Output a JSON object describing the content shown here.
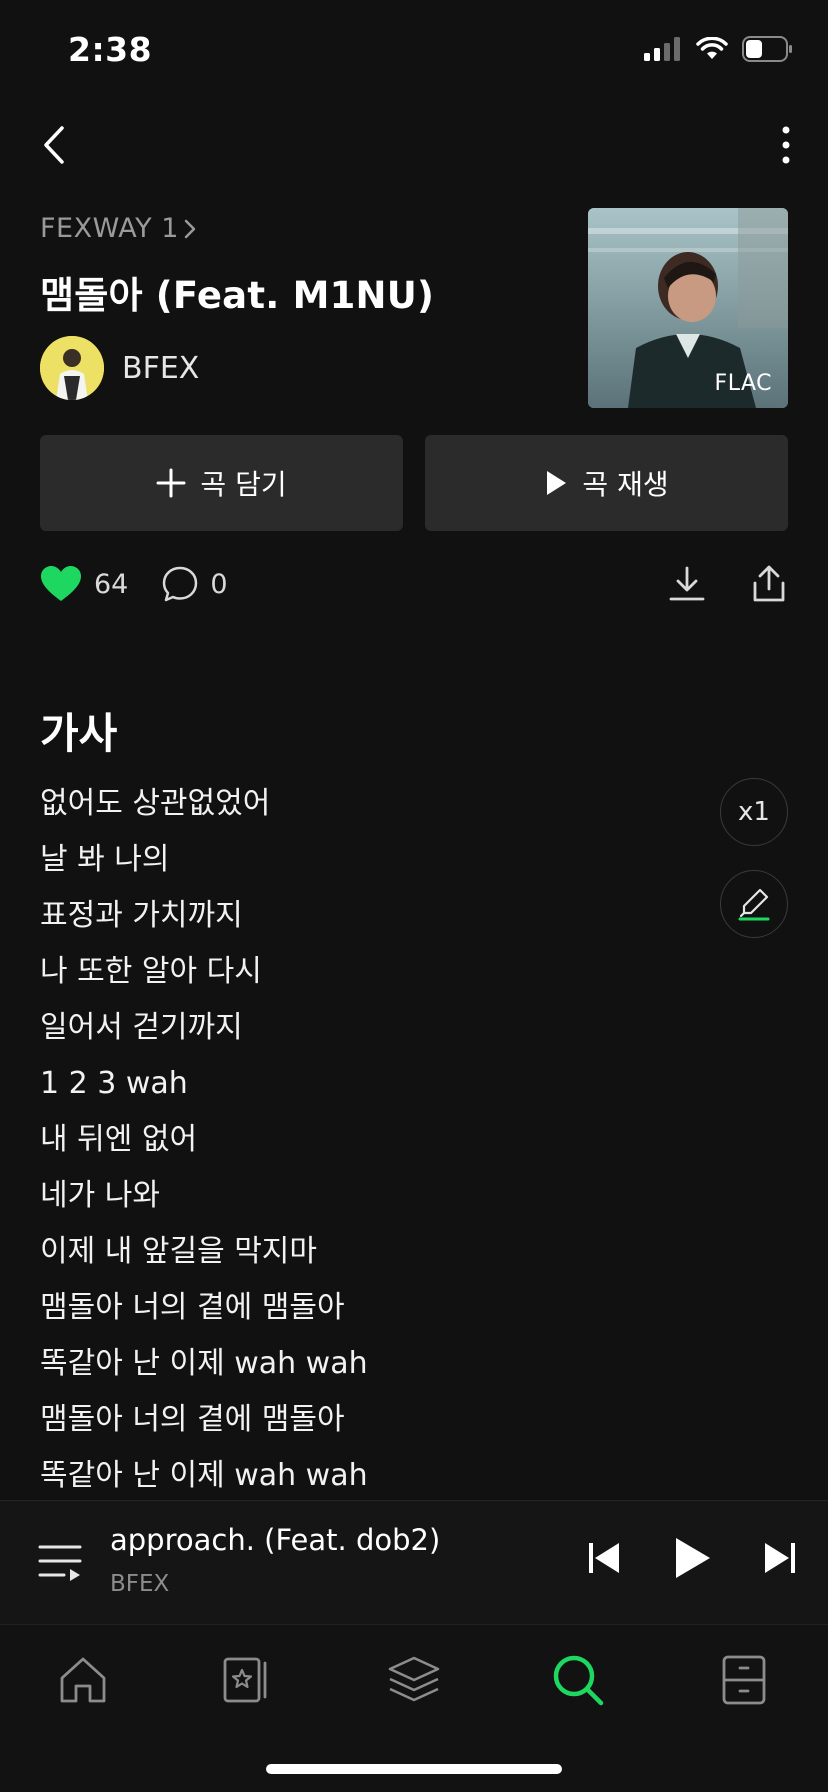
{
  "status_bar": {
    "time": "2:38"
  },
  "song": {
    "album": "FEXWAY 1",
    "title": "맴돌아 (Feat. M1NU)",
    "artist": "BFEX",
    "quality_badge": "FLAC"
  },
  "actions": {
    "add_label": "곡 담기",
    "play_label": "곡 재생"
  },
  "stats": {
    "likes": "64",
    "comments": "0"
  },
  "lyrics": {
    "heading": "가사",
    "speed_label": "x1",
    "lines": [
      "없어도 상관없었어",
      "날 봐 나의",
      "표정과 가치까지",
      "나 또한 알아 다시",
      "일어서 걷기까지",
      "1 2 3 wah",
      "내 뒤엔 없어",
      "네가 나와",
      "이제 내 앞길을 막지마",
      "맴돌아 너의 곁에 맴돌아",
      "똑같아 난 이제 wah wah",
      "맴돌아 너의 곁에 맴돌아",
      "똑같아 난 이제 wah wah"
    ]
  },
  "mini_player": {
    "title": "approach. (Feat. dob2)",
    "artist": "BFEX"
  },
  "colors": {
    "accent": "#1ed760",
    "background": "#111111",
    "button": "#2b2b2b"
  },
  "tabs": [
    {
      "icon": "home-icon",
      "active": false
    },
    {
      "icon": "playlist-star-icon",
      "active": false
    },
    {
      "icon": "layers-icon",
      "active": false
    },
    {
      "icon": "search-icon",
      "active": true
    },
    {
      "icon": "storage-icon",
      "active": false
    }
  ]
}
